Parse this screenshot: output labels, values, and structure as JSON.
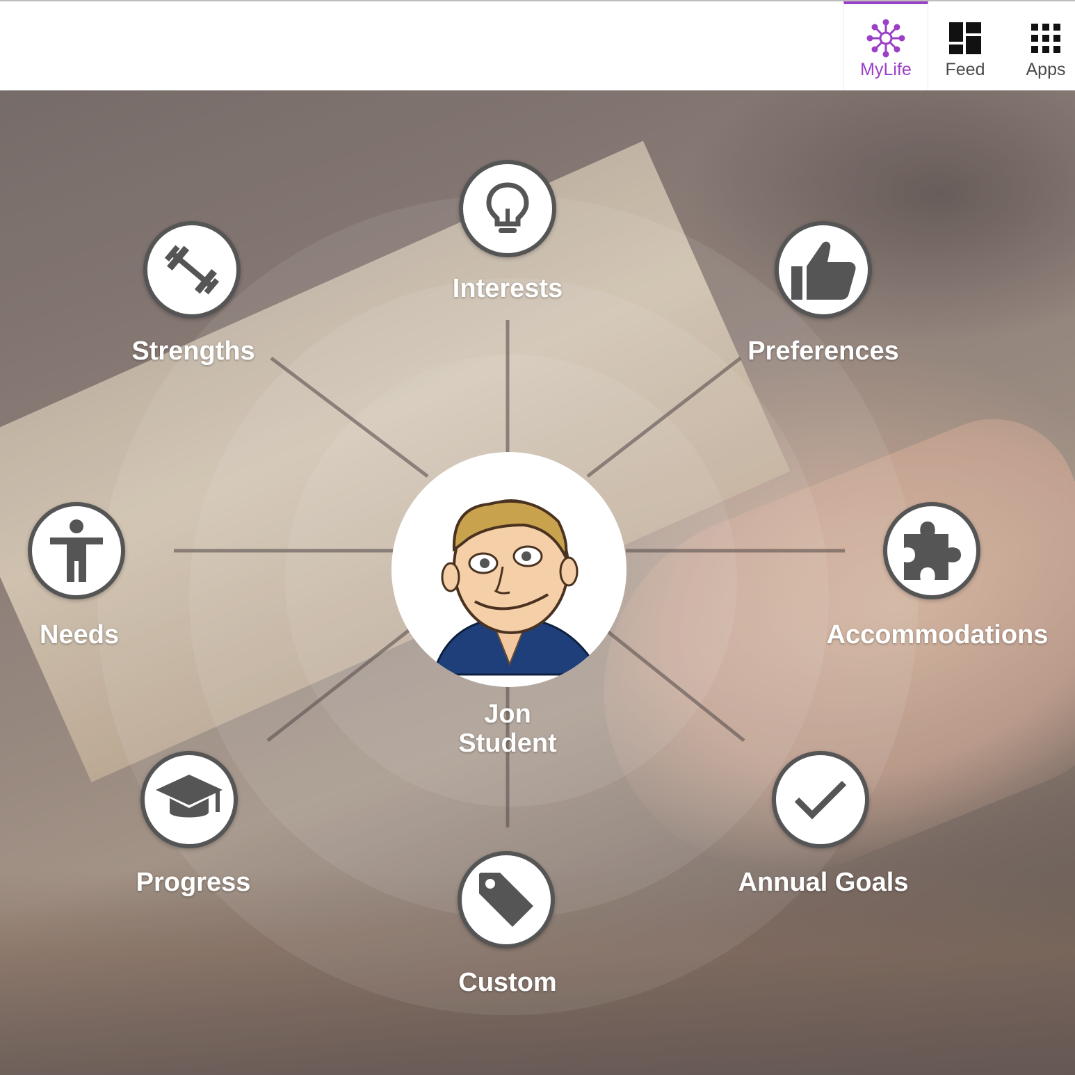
{
  "nav": {
    "tabs": [
      {
        "label": "MyLife",
        "icon": "mylife-network-icon",
        "active": true
      },
      {
        "label": "Feed",
        "icon": "dashboard-grid-icon",
        "active": false
      },
      {
        "label": "Apps",
        "icon": "apps-grid-icon",
        "active": false
      }
    ]
  },
  "colors": {
    "accent": "#9b3fc6",
    "icon_dark": "#555555",
    "label_white": "#ffffff"
  },
  "student": {
    "first_name": "Jon",
    "last_name": "Student"
  },
  "categories": [
    {
      "label": "Interests",
      "icon": "lightbulb-icon"
    },
    {
      "label": "Preferences",
      "icon": "thumbs-up-icon"
    },
    {
      "label": "Accommodations",
      "icon": "puzzle-piece-icon"
    },
    {
      "label": "Annual Goals",
      "icon": "checkmark-icon"
    },
    {
      "label": "Custom",
      "icon": "tag-icon"
    },
    {
      "label": "Progress",
      "icon": "graduation-cap-icon"
    },
    {
      "label": "Needs",
      "icon": "accessibility-person-icon"
    },
    {
      "label": "Strengths",
      "icon": "dumbbell-icon"
    }
  ]
}
